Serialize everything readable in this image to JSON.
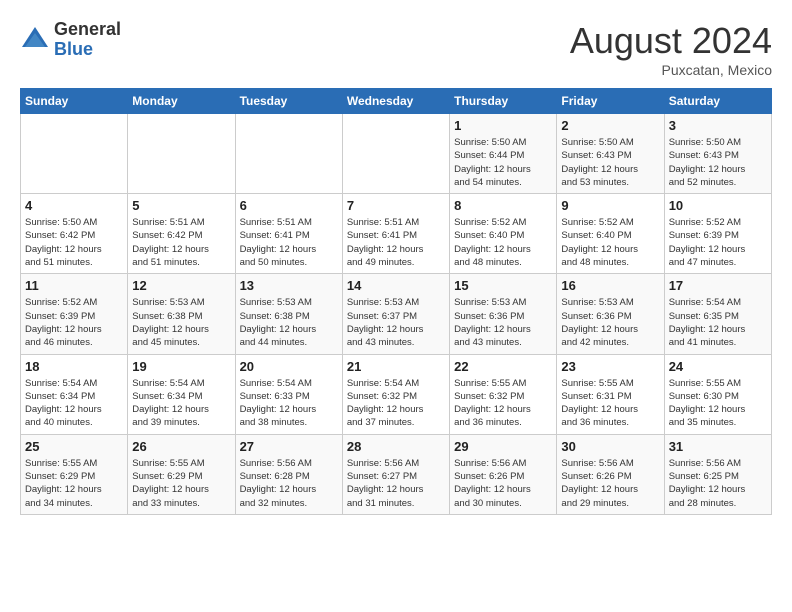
{
  "logo": {
    "general": "General",
    "blue": "Blue"
  },
  "title": {
    "month_year": "August 2024",
    "location": "Puxcatan, Mexico"
  },
  "days_of_week": [
    "Sunday",
    "Monday",
    "Tuesday",
    "Wednesday",
    "Thursday",
    "Friday",
    "Saturday"
  ],
  "weeks": [
    [
      {
        "day": "",
        "info": ""
      },
      {
        "day": "",
        "info": ""
      },
      {
        "day": "",
        "info": ""
      },
      {
        "day": "",
        "info": ""
      },
      {
        "day": "1",
        "info": "Sunrise: 5:50 AM\nSunset: 6:44 PM\nDaylight: 12 hours\nand 54 minutes."
      },
      {
        "day": "2",
        "info": "Sunrise: 5:50 AM\nSunset: 6:43 PM\nDaylight: 12 hours\nand 53 minutes."
      },
      {
        "day": "3",
        "info": "Sunrise: 5:50 AM\nSunset: 6:43 PM\nDaylight: 12 hours\nand 52 minutes."
      }
    ],
    [
      {
        "day": "4",
        "info": "Sunrise: 5:50 AM\nSunset: 6:42 PM\nDaylight: 12 hours\nand 51 minutes."
      },
      {
        "day": "5",
        "info": "Sunrise: 5:51 AM\nSunset: 6:42 PM\nDaylight: 12 hours\nand 51 minutes."
      },
      {
        "day": "6",
        "info": "Sunrise: 5:51 AM\nSunset: 6:41 PM\nDaylight: 12 hours\nand 50 minutes."
      },
      {
        "day": "7",
        "info": "Sunrise: 5:51 AM\nSunset: 6:41 PM\nDaylight: 12 hours\nand 49 minutes."
      },
      {
        "day": "8",
        "info": "Sunrise: 5:52 AM\nSunset: 6:40 PM\nDaylight: 12 hours\nand 48 minutes."
      },
      {
        "day": "9",
        "info": "Sunrise: 5:52 AM\nSunset: 6:40 PM\nDaylight: 12 hours\nand 48 minutes."
      },
      {
        "day": "10",
        "info": "Sunrise: 5:52 AM\nSunset: 6:39 PM\nDaylight: 12 hours\nand 47 minutes."
      }
    ],
    [
      {
        "day": "11",
        "info": "Sunrise: 5:52 AM\nSunset: 6:39 PM\nDaylight: 12 hours\nand 46 minutes."
      },
      {
        "day": "12",
        "info": "Sunrise: 5:53 AM\nSunset: 6:38 PM\nDaylight: 12 hours\nand 45 minutes."
      },
      {
        "day": "13",
        "info": "Sunrise: 5:53 AM\nSunset: 6:38 PM\nDaylight: 12 hours\nand 44 minutes."
      },
      {
        "day": "14",
        "info": "Sunrise: 5:53 AM\nSunset: 6:37 PM\nDaylight: 12 hours\nand 43 minutes."
      },
      {
        "day": "15",
        "info": "Sunrise: 5:53 AM\nSunset: 6:36 PM\nDaylight: 12 hours\nand 43 minutes."
      },
      {
        "day": "16",
        "info": "Sunrise: 5:53 AM\nSunset: 6:36 PM\nDaylight: 12 hours\nand 42 minutes."
      },
      {
        "day": "17",
        "info": "Sunrise: 5:54 AM\nSunset: 6:35 PM\nDaylight: 12 hours\nand 41 minutes."
      }
    ],
    [
      {
        "day": "18",
        "info": "Sunrise: 5:54 AM\nSunset: 6:34 PM\nDaylight: 12 hours\nand 40 minutes."
      },
      {
        "day": "19",
        "info": "Sunrise: 5:54 AM\nSunset: 6:34 PM\nDaylight: 12 hours\nand 39 minutes."
      },
      {
        "day": "20",
        "info": "Sunrise: 5:54 AM\nSunset: 6:33 PM\nDaylight: 12 hours\nand 38 minutes."
      },
      {
        "day": "21",
        "info": "Sunrise: 5:54 AM\nSunset: 6:32 PM\nDaylight: 12 hours\nand 37 minutes."
      },
      {
        "day": "22",
        "info": "Sunrise: 5:55 AM\nSunset: 6:32 PM\nDaylight: 12 hours\nand 36 minutes."
      },
      {
        "day": "23",
        "info": "Sunrise: 5:55 AM\nSunset: 6:31 PM\nDaylight: 12 hours\nand 36 minutes."
      },
      {
        "day": "24",
        "info": "Sunrise: 5:55 AM\nSunset: 6:30 PM\nDaylight: 12 hours\nand 35 minutes."
      }
    ],
    [
      {
        "day": "25",
        "info": "Sunrise: 5:55 AM\nSunset: 6:29 PM\nDaylight: 12 hours\nand 34 minutes."
      },
      {
        "day": "26",
        "info": "Sunrise: 5:55 AM\nSunset: 6:29 PM\nDaylight: 12 hours\nand 33 minutes."
      },
      {
        "day": "27",
        "info": "Sunrise: 5:56 AM\nSunset: 6:28 PM\nDaylight: 12 hours\nand 32 minutes."
      },
      {
        "day": "28",
        "info": "Sunrise: 5:56 AM\nSunset: 6:27 PM\nDaylight: 12 hours\nand 31 minutes."
      },
      {
        "day": "29",
        "info": "Sunrise: 5:56 AM\nSunset: 6:26 PM\nDaylight: 12 hours\nand 30 minutes."
      },
      {
        "day": "30",
        "info": "Sunrise: 5:56 AM\nSunset: 6:26 PM\nDaylight: 12 hours\nand 29 minutes."
      },
      {
        "day": "31",
        "info": "Sunrise: 5:56 AM\nSunset: 6:25 PM\nDaylight: 12 hours\nand 28 minutes."
      }
    ]
  ]
}
